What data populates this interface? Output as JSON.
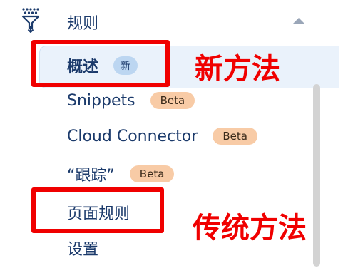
{
  "sidebar": {
    "group": {
      "icon": "filter-icon",
      "label": "规则",
      "collapse_icon": "chevron-up-icon"
    },
    "items": [
      {
        "label": "概述",
        "badge": "新",
        "active": true
      },
      {
        "label": "Snippets",
        "badge": "Beta"
      },
      {
        "label": "Cloud Connector",
        "badge": "Beta"
      },
      {
        "label": "“跟踪”",
        "badge": "Beta"
      },
      {
        "label": "页面规则"
      },
      {
        "label": "设置"
      }
    ]
  },
  "annotations": {
    "new_method": "新方法",
    "traditional_method": "传统方法",
    "color": "#f00000"
  },
  "colors": {
    "text": "#1b3a6b",
    "active_bg": "#eaf2fb",
    "badge_new_bg": "#bcd6f1",
    "badge_beta_bg": "#f8cba6"
  }
}
